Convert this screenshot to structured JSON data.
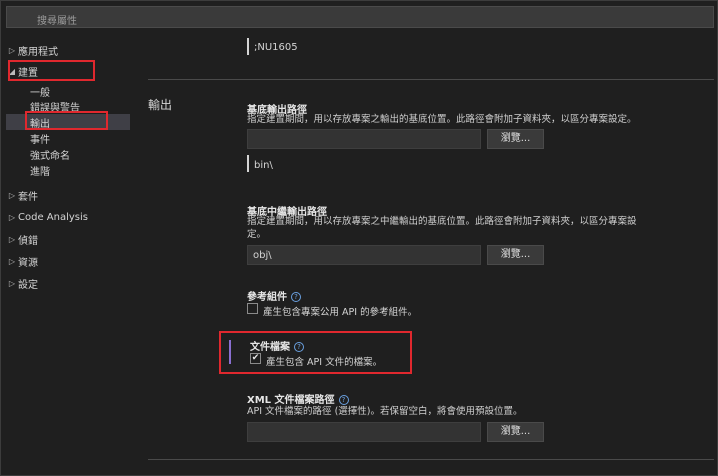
{
  "search": {
    "placeholder": "搜尋屬性"
  },
  "sidebar": {
    "items": [
      {
        "label": "應用程式",
        "chevron": "▷"
      },
      {
        "label": "建置",
        "chevron": "◢"
      },
      {
        "label": "一般"
      },
      {
        "label": "錯誤與警告"
      },
      {
        "label": "輸出"
      },
      {
        "label": "事件"
      },
      {
        "label": "強式命名"
      },
      {
        "label": "進階"
      },
      {
        "label": "套件",
        "chevron": "▷"
      },
      {
        "label": "Code Analysis",
        "chevron": "▷"
      },
      {
        "label": "偵錯",
        "chevron": "▷"
      },
      {
        "label": "資源",
        "chevron": "▷"
      },
      {
        "label": "設定",
        "chevron": "▷"
      }
    ]
  },
  "top_value": ";NU1605",
  "output": {
    "section_title": "輸出",
    "base_output": {
      "label": "基底輸出路徑",
      "desc": "指定建置期間，用以存放專案之輸出的基底位置。此路徑會附加子資料夾，以區分專案設定。",
      "browse": "瀏覽...",
      "value": "bin\\"
    },
    "base_intermediate": {
      "label": "基底中繼輸出路徑",
      "desc": "指定建置期間，用以存放專案之中繼輸出的基底位置。此路徑會附加子資料夾，以區分專案設定。",
      "value": "obj\\",
      "browse": "瀏覽..."
    },
    "reference_assembly": {
      "label": "參考組件",
      "checkbox_label": "產生包含專案公用 API 的參考組件。",
      "checked": false
    },
    "documentation_file": {
      "label": "文件檔案",
      "checkbox_label": "產生包含 API 文件的檔案。",
      "checked": true
    },
    "xml_doc_path": {
      "label": "XML 文件檔案路徑",
      "desc": "API 文件檔案的路徑 (選擇性)。若保留空白，將會使用預設位置。",
      "browse": "瀏覽..."
    }
  },
  "colors": {
    "highlight": "#e0282e",
    "accent_bar": "#8a6fd1",
    "selected_bg": "#3f3f46"
  }
}
